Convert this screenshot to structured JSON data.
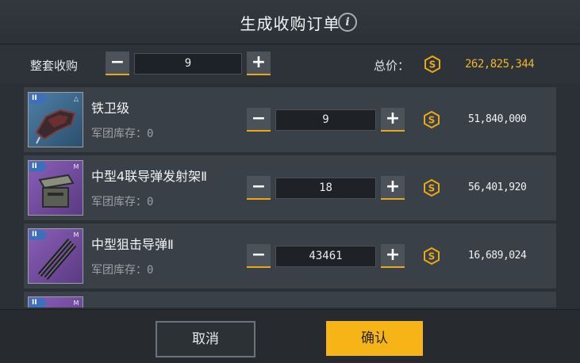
{
  "header": {
    "title": "生成收购订单",
    "info_glyph": "i"
  },
  "topbar": {
    "bulk_label": "整套收购",
    "bulk_qty": "9",
    "minus": "−",
    "plus": "+",
    "total_label": "总价：",
    "total_value": "262,825,344"
  },
  "items": [
    {
      "name": "铁卫级",
      "stock_label": "军团库存：",
      "stock": "0",
      "qty": "9",
      "price": "51,840,000",
      "tier": "II",
      "size": "△",
      "color": "blue"
    },
    {
      "name": "中型4联导弹发射架Ⅱ",
      "stock_label": "军团库存：",
      "stock": "0",
      "qty": "18",
      "price": "56,401,920",
      "tier": "II",
      "size": "M",
      "color": "purple"
    },
    {
      "name": "中型狙击导弹Ⅱ",
      "stock_label": "军团库存：",
      "stock": "0",
      "qty": "43461",
      "price": "16,689,024",
      "tier": "II",
      "size": "M",
      "color": "purple"
    },
    {
      "name": "",
      "stock_label": "",
      "stock": "",
      "qty": "",
      "price": "",
      "tier": "II",
      "size": "M",
      "color": "purple"
    }
  ],
  "footer": {
    "cancel": "取消",
    "confirm": "确认"
  },
  "colors": {
    "accent": "#f6b416",
    "coin": "#e8a818"
  },
  "icons": {
    "coin": "coin-icon",
    "info": "info-icon"
  }
}
